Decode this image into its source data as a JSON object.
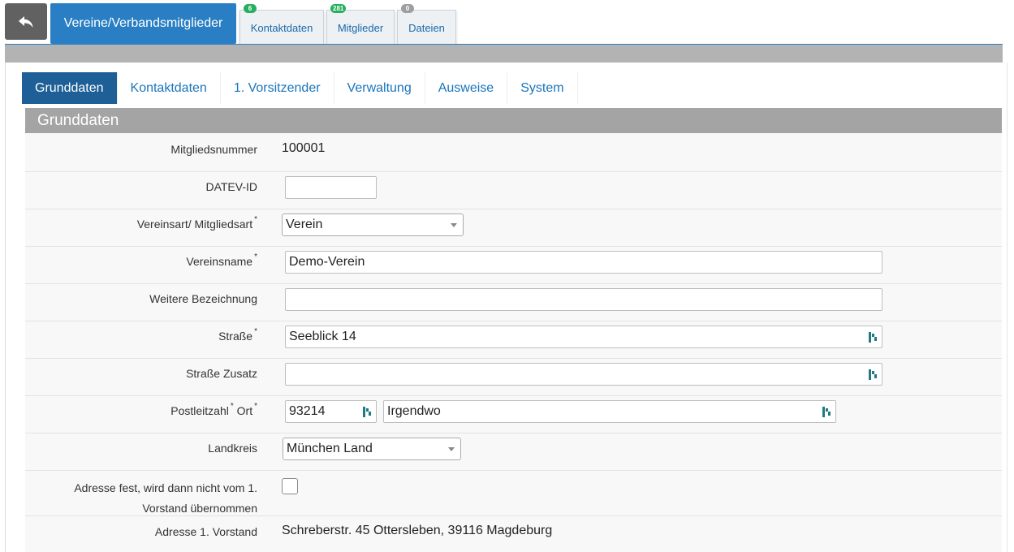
{
  "header": {
    "back_icon": "reply-arrow-icon",
    "main_tab": "Vereine/Verbandsmitglieder",
    "subtabs": [
      {
        "label": "Kontaktdaten",
        "badge": "6",
        "badge_color": "#27ae60"
      },
      {
        "label": "Mitglieder",
        "badge": "281",
        "badge_color": "#27ae60"
      },
      {
        "label": "Dateien",
        "badge": "0",
        "badge_color": "#9e9e9e"
      }
    ]
  },
  "tabs": [
    "Grunddaten",
    "Kontaktdaten",
    "1. Vorsitzender",
    "Verwaltung",
    "Ausweise",
    "System"
  ],
  "section_title": "Grunddaten",
  "form": {
    "mitgliedsnummer": {
      "label": "Mitgliedsnummer",
      "value": "100001"
    },
    "datev": {
      "label": "DATEV-ID",
      "value": ""
    },
    "vereinsart": {
      "label": "Vereinsart/ Mitgliedsart",
      "required": "*",
      "value": "Verein"
    },
    "vereinsname": {
      "label": "Vereinsname",
      "required": "*",
      "value": "Demo-Verein"
    },
    "weitere": {
      "label": "Weitere Bezeichnung",
      "value": ""
    },
    "strasse": {
      "label": "Straße",
      "required": "*",
      "value": "Seeblick 14"
    },
    "strasse_zusatz": {
      "label": "Straße Zusatz",
      "value": ""
    },
    "plz_ort": {
      "label_plz": "Postleitzahl",
      "label_ort": "Ort",
      "required": "*",
      "plz": "93214",
      "ort": "Irgendwo"
    },
    "landkreis": {
      "label": "Landkreis",
      "value": "München Land"
    },
    "adresse_fest": {
      "label_line1": "Adresse fest, wird dann nicht vom 1.",
      "label_line2": "Vorstand übernommen",
      "checked": false
    },
    "adresse_vorstand": {
      "label": "Adresse 1. Vorstand",
      "value": "Schreberstr. 45 Ottersleben, 39116 Magdeburg"
    }
  },
  "colors": {
    "primary": "#2a7fc4",
    "active_tab": "#1d5f96",
    "section_header": "#a4a4a4",
    "link": "#1a75bc"
  }
}
